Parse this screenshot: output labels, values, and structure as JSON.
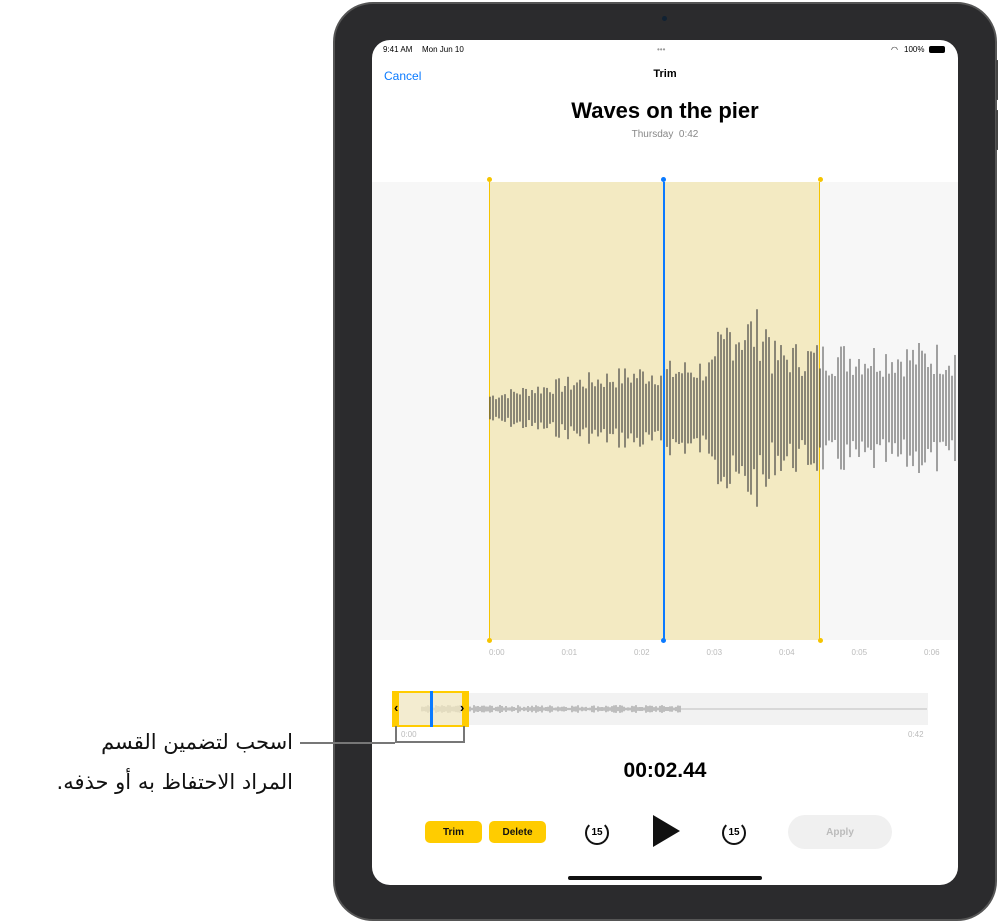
{
  "status": {
    "time": "9:41 AM",
    "date": "Mon Jun 10",
    "battery": "100%"
  },
  "nav": {
    "cancel": "Cancel",
    "title": "Trim"
  },
  "recording": {
    "title": "Waves on the pier",
    "day": "Thursday",
    "duration": "0:42"
  },
  "timeline": {
    "ticks": [
      "0:00",
      "0:01",
      "0:02",
      "0:03",
      "0:04",
      "0:05",
      "0:06"
    ]
  },
  "overview": {
    "start": "0:00",
    "end": "0:42"
  },
  "playback": {
    "time": "00:02.44"
  },
  "controls": {
    "trim": "Trim",
    "delete": "Delete",
    "skip_back": "15",
    "skip_forward": "15",
    "apply": "Apply"
  },
  "callout": {
    "line1": "اسحب لتضمين القسم",
    "line2": "المراد الاحتفاظ به أو حذفه."
  },
  "colors": {
    "accent": "#ffcc00",
    "playhead": "#0a7aff",
    "link": "#0a7aff"
  }
}
